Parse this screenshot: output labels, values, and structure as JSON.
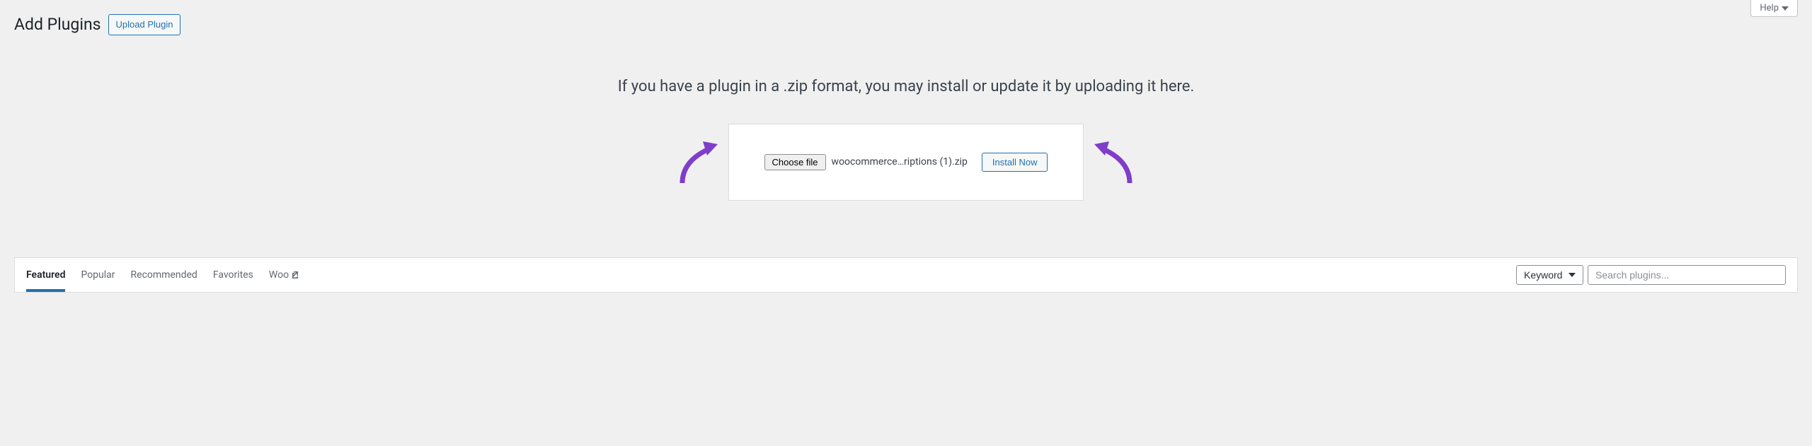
{
  "header": {
    "title": "Add Plugins",
    "upload_button": "Upload Plugin",
    "help_label": "Help"
  },
  "upload": {
    "instructions": "If you have a plugin in a .zip format, you may install or update it by uploading it here.",
    "choose_file_label": "Choose file",
    "selected_file": "woocommerce…riptions (1).zip",
    "install_button": "Install Now"
  },
  "filter": {
    "tabs": [
      {
        "label": "Featured",
        "active": true
      },
      {
        "label": "Popular",
        "active": false
      },
      {
        "label": "Recommended",
        "active": false
      },
      {
        "label": "Favorites",
        "active": false
      },
      {
        "label": "Woo",
        "active": false,
        "external": true
      }
    ],
    "keyword_label": "Keyword",
    "search_placeholder": "Search plugins..."
  },
  "colors": {
    "accent": "#2271b1",
    "arrow": "#7f3ec9"
  }
}
